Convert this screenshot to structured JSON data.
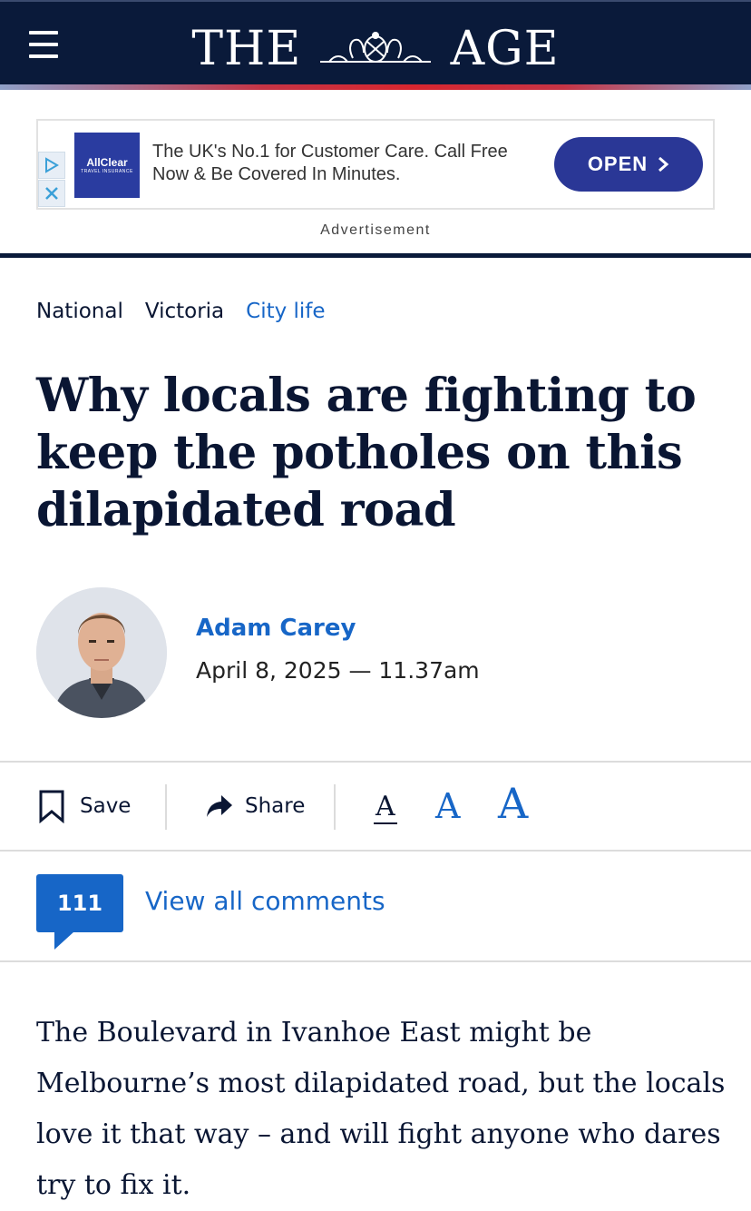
{
  "header": {
    "masthead_left": "THE",
    "masthead_right": "AGE",
    "colors": {
      "background": "#0a1a3a",
      "accent_line": "#d8262f"
    }
  },
  "ad": {
    "logo_brand": "AllClear",
    "logo_sub": "TRAVEL INSURANCE",
    "text": "The UK's No.1 for Customer Care. Call Free Now & Be Covered In Minutes.",
    "button_label": "OPEN",
    "label": "Advertisement"
  },
  "breadcrumbs": [
    {
      "label": "National"
    },
    {
      "label": "Victoria"
    },
    {
      "label": "City life"
    }
  ],
  "article": {
    "headline": "Why locals are fighting to keep the potholes on this dilapidated road",
    "author": "Adam Carey",
    "date": "April 8, 2025 — 11.37am",
    "body": "The Boulevard in Ivanhoe East might be Melbourne’s most dilapidated road, but the locals love it that way – and will fight anyone who dares try to fix it."
  },
  "toolbar": {
    "save_label": "Save",
    "share_label": "Share",
    "font_small": "A",
    "font_medium": "A",
    "font_large": "A"
  },
  "comments": {
    "count": "111",
    "link_label": "View all comments"
  },
  "colors": {
    "link_blue": "#1766c7",
    "text_navy": "#0a1633"
  }
}
